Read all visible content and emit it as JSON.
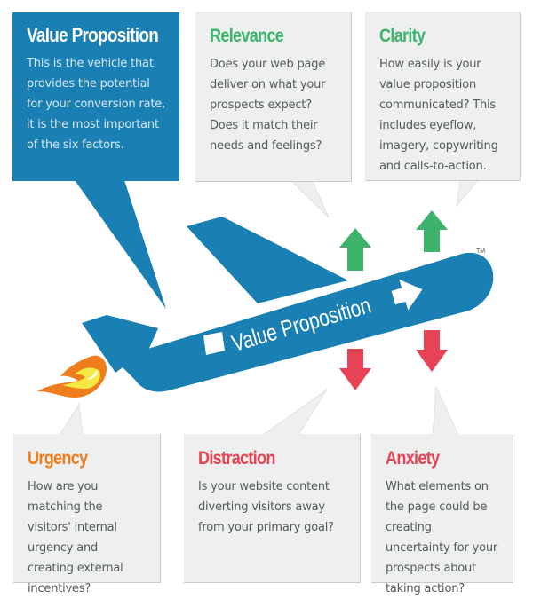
{
  "diagram": {
    "factors": {
      "value_proposition": {
        "title": "Value Proposition",
        "body": "This is the vehicle that provides the potential for your conversion rate, it is the most important of the six factors."
      },
      "relevance": {
        "title": "Relevance",
        "body": "Does your web page deliver on what your prospects expect? Does it match their needs and feelings?"
      },
      "clarity": {
        "title": "Clarity",
        "body": "How easily is your value proposition communicated? This includes eyeflow, imagery, copywriting and calls-to-action."
      },
      "urgency": {
        "title": "Urgency",
        "body": "How are you matching the visitors' internal urgency and creating external incentives?"
      },
      "distraction": {
        "title": "Distraction",
        "body": "Is your website content diverting visitors away from your primary goal?"
      },
      "anxiety": {
        "title": "Anxiety",
        "body": "What elements on the page could be creating uncertainty for your prospects about taking action?"
      }
    },
    "plane": {
      "label": "Value Proposition",
      "trademark": "TM"
    },
    "colors": {
      "blue": "#1a80b4",
      "green": "#3db36c",
      "orange": "#f07d1d",
      "red": "#e64356",
      "box_gray": "#eeefef",
      "flame_yellow": "#f4e842"
    }
  }
}
